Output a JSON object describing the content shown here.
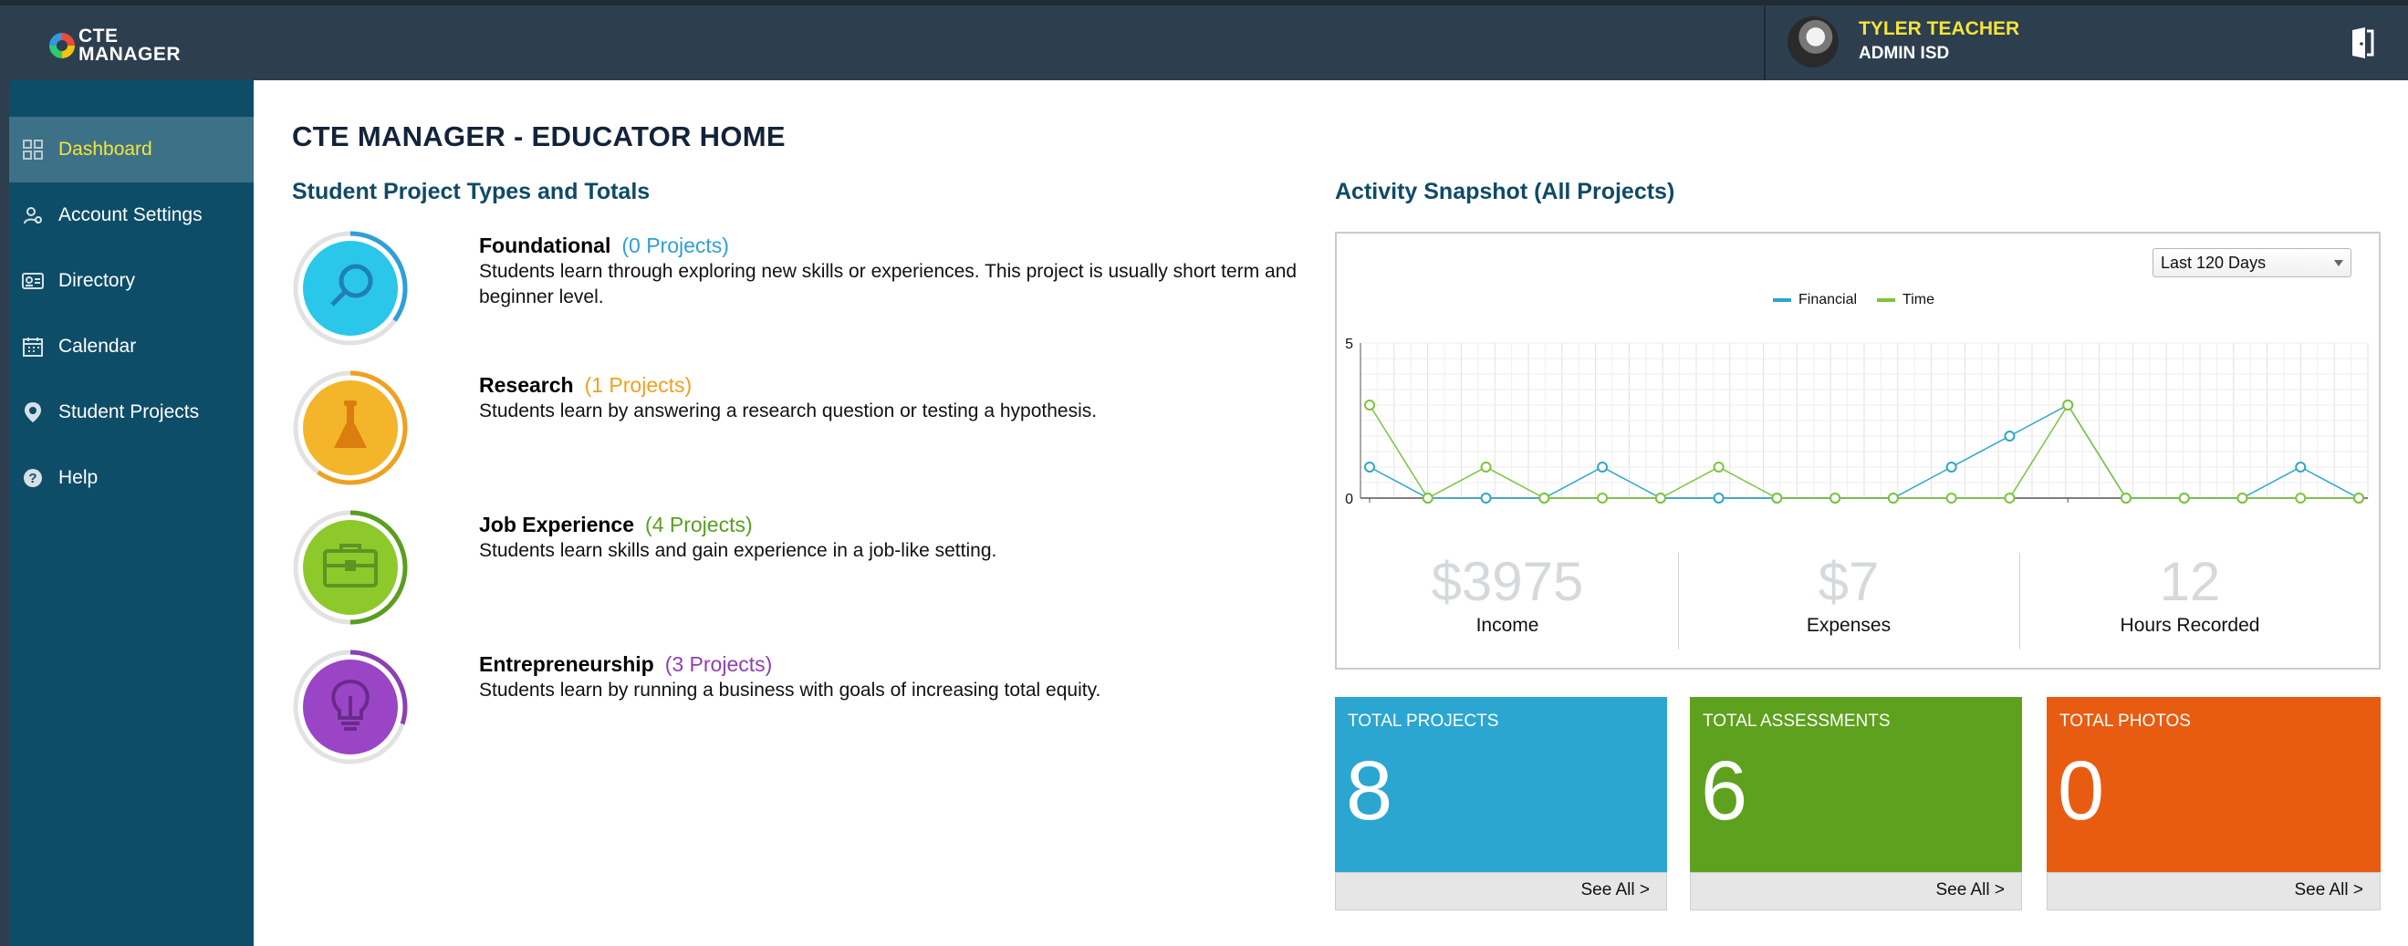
{
  "app": {
    "logo_line1": "CTE",
    "logo_line2": "MANAGER",
    "user_name": "TYLER TEACHER",
    "user_org": "ADMIN ISD"
  },
  "sidebar": {
    "items": [
      {
        "label": "Dashboard",
        "icon": "dashboard-grid-icon",
        "active": true
      },
      {
        "label": "Account Settings",
        "icon": "user-gear-icon",
        "active": false
      },
      {
        "label": "Directory",
        "icon": "id-card-icon",
        "active": false
      },
      {
        "label": "Calendar",
        "icon": "calendar-icon",
        "active": false
      },
      {
        "label": "Student Projects",
        "icon": "project-pin-icon",
        "active": false
      },
      {
        "label": "Help",
        "icon": "help-icon",
        "active": false
      }
    ]
  },
  "main": {
    "title": "CTE MANAGER - EDUCATOR HOME",
    "project_types_title": "Student Project Types and Totals",
    "project_types": [
      {
        "name": "Foundational",
        "count": "(0 Projects)",
        "desc": "Students learn through exploring new skills or experiences. This project is usually short term and beginner level.",
        "color": "#2f9fd8",
        "fill": "#2bc7ea",
        "icon": "magnifier-icon",
        "ring_fraction": 0.35
      },
      {
        "name": "Research",
        "count": "(1 Projects)",
        "desc": "Students learn by answering a research question or testing a hypothesis.",
        "color": "#f0a020",
        "fill": "#f5b52a",
        "icon": "flask-icon",
        "ring_fraction": 0.6
      },
      {
        "name": "Job Experience",
        "count": "(4 Projects)",
        "desc": "Students learn skills and gain experience in a job-like setting.",
        "color": "#5a9e1f",
        "fill": "#8ec92c",
        "icon": "briefcase-icon",
        "ring_fraction": 0.5
      },
      {
        "name": "Entrepreneurship",
        "count": "(3 Projects)",
        "desc": "Students learn by running a business with goals of increasing total equity.",
        "color": "#8e3fb3",
        "fill": "#9a45c6",
        "icon": "lightbulb-icon",
        "ring_fraction": 0.3
      }
    ],
    "activity_title": "Activity Snapshot (All Projects)",
    "range_select": "Last 120 Days",
    "stats": [
      {
        "value": "$3975",
        "caption": "Income"
      },
      {
        "value": "$7",
        "caption": "Expenses"
      },
      {
        "value": "12",
        "caption": "Hours Recorded"
      }
    ],
    "tiles": [
      {
        "title": "TOTAL PROJECTS",
        "value": "8",
        "link": "See All >",
        "color": "#2ba6d1"
      },
      {
        "title": "TOTAL ASSESSMENTS",
        "value": "6",
        "link": "See All >",
        "color": "#5da11e"
      },
      {
        "title": "TOTAL PHOTOS",
        "value": "0",
        "link": "See All >",
        "color": "#e85c12"
      }
    ]
  },
  "chart_data": {
    "type": "line",
    "x": [
      1,
      2,
      3,
      4,
      5,
      6,
      7,
      8,
      9,
      10,
      11,
      12,
      13,
      14,
      15,
      16,
      17,
      18
    ],
    "series": [
      {
        "name": "Financial",
        "color": "#2ba6c9",
        "values": [
          1,
          0,
          0,
          0,
          1,
          0,
          0,
          0,
          0,
          0,
          1,
          2,
          3,
          0,
          0,
          0,
          1,
          0
        ]
      },
      {
        "name": "Time",
        "color": "#7cc43a",
        "values": [
          3,
          0,
          1,
          0,
          0,
          0,
          1,
          0,
          0,
          0,
          0,
          0,
          3,
          0,
          0,
          0,
          0,
          0
        ]
      }
    ],
    "ylim": [
      0,
      5
    ],
    "yticks": [
      "0",
      "5"
    ],
    "grid": true,
    "legend": "top-center"
  }
}
